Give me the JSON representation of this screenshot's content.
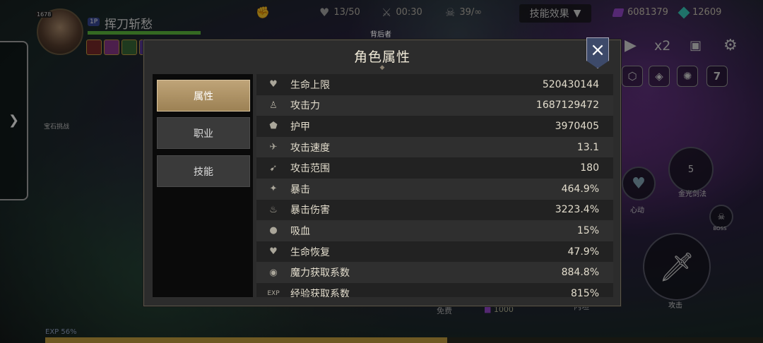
{
  "hud": {
    "player_level": "1678",
    "player_tag": "1P",
    "player_name": "挥刀斩愁",
    "wave": "13/50",
    "timer": "00:30",
    "kills": "39/∞",
    "skill_effect_label": "技能效果",
    "purple_currency": "6081379",
    "cyan_currency": "12609",
    "speed_label": "x2",
    "gem_challenge_label": "宝石挑战",
    "skill_gold_sword": "金光剑法",
    "skill_heart": "心动",
    "boss_label": "BOSS",
    "attack_label": "攻击",
    "exp_label": "EXP 56%",
    "exp_percent": 56,
    "free_label": "免费",
    "cost_label": "1000",
    "top_center_label": "背后者",
    "bottom_right_hint": "内坦",
    "skill_number": "7",
    "skill_cooldown": "5"
  },
  "modal": {
    "title": "角色属性",
    "tabs": [
      {
        "label": "属性",
        "active": true
      },
      {
        "label": "职业",
        "active": false
      },
      {
        "label": "技能",
        "active": false
      }
    ],
    "stats": [
      {
        "icon": "heart-icon",
        "name": "生命上限",
        "value": "520430144"
      },
      {
        "icon": "sword-icon",
        "name": "攻击力",
        "value": "1687129472"
      },
      {
        "icon": "shield-icon",
        "name": "护甲",
        "value": "3970405"
      },
      {
        "icon": "runner-icon",
        "name": "攻击速度",
        "value": "13.1"
      },
      {
        "icon": "bow-icon",
        "name": "攻击范围",
        "value": "180"
      },
      {
        "icon": "crit-icon",
        "name": "暴击",
        "value": "464.9%"
      },
      {
        "icon": "flame-icon",
        "name": "暴击伤害",
        "value": "3223.4%"
      },
      {
        "icon": "drop-icon",
        "name": "吸血",
        "value": "15%"
      },
      {
        "icon": "heart-regen-icon",
        "name": "生命恢复",
        "value": "47.9%"
      },
      {
        "icon": "bomb-icon",
        "name": "魔力获取系数",
        "value": "884.8%"
      },
      {
        "icon": "exp-icon",
        "name": "经验获取系数",
        "value": "815%"
      }
    ]
  }
}
